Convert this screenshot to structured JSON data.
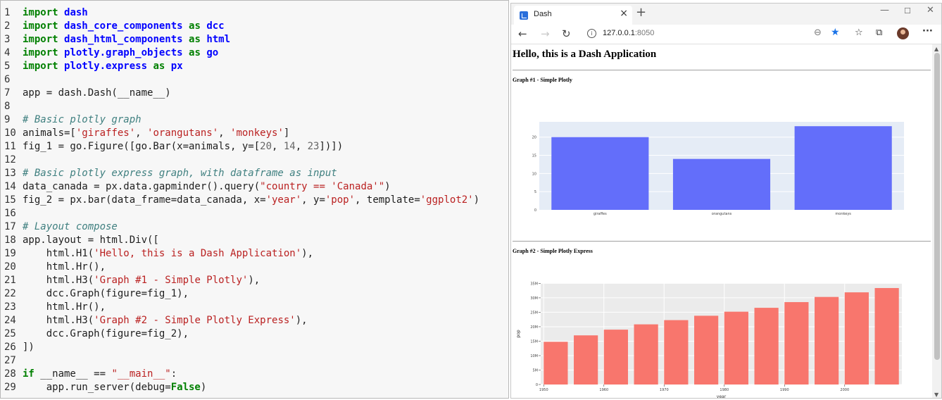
{
  "editor": {
    "lines": [
      {
        "n": "1",
        "tokens": [
          {
            "t": "kw",
            "v": "import"
          },
          {
            "t": "plain",
            "v": " "
          },
          {
            "t": "mod",
            "v": "dash"
          }
        ]
      },
      {
        "n": "2",
        "tokens": [
          {
            "t": "kw",
            "v": "import"
          },
          {
            "t": "plain",
            "v": " "
          },
          {
            "t": "mod",
            "v": "dash_core_components"
          },
          {
            "t": "plain",
            "v": " "
          },
          {
            "t": "kw",
            "v": "as"
          },
          {
            "t": "plain",
            "v": " "
          },
          {
            "t": "mod",
            "v": "dcc"
          }
        ]
      },
      {
        "n": "3",
        "tokens": [
          {
            "t": "kw",
            "v": "import"
          },
          {
            "t": "plain",
            "v": " "
          },
          {
            "t": "mod",
            "v": "dash_html_components"
          },
          {
            "t": "plain",
            "v": " "
          },
          {
            "t": "kw",
            "v": "as"
          },
          {
            "t": "plain",
            "v": " "
          },
          {
            "t": "mod",
            "v": "html"
          }
        ]
      },
      {
        "n": "4",
        "tokens": [
          {
            "t": "kw",
            "v": "import"
          },
          {
            "t": "plain",
            "v": " "
          },
          {
            "t": "mod",
            "v": "plotly.graph_objects"
          },
          {
            "t": "plain",
            "v": " "
          },
          {
            "t": "kw",
            "v": "as"
          },
          {
            "t": "plain",
            "v": " "
          },
          {
            "t": "mod",
            "v": "go"
          }
        ]
      },
      {
        "n": "5",
        "tokens": [
          {
            "t": "kw",
            "v": "import"
          },
          {
            "t": "plain",
            "v": " "
          },
          {
            "t": "mod",
            "v": "plotly.express"
          },
          {
            "t": "plain",
            "v": " "
          },
          {
            "t": "kw",
            "v": "as"
          },
          {
            "t": "plain",
            "v": " "
          },
          {
            "t": "mod",
            "v": "px"
          }
        ]
      },
      {
        "n": "6",
        "tokens": []
      },
      {
        "n": "7",
        "tokens": [
          {
            "t": "plain",
            "v": "app = dash.Dash(__name__)"
          }
        ]
      },
      {
        "n": "8",
        "tokens": []
      },
      {
        "n": "9",
        "tokens": [
          {
            "t": "com",
            "v": "# Basic plotly graph"
          }
        ]
      },
      {
        "n": "10",
        "tokens": [
          {
            "t": "plain",
            "v": "animals=["
          },
          {
            "t": "str",
            "v": "'giraffes'"
          },
          {
            "t": "plain",
            "v": ", "
          },
          {
            "t": "str",
            "v": "'orangutans'"
          },
          {
            "t": "plain",
            "v": ", "
          },
          {
            "t": "str",
            "v": "'monkeys'"
          },
          {
            "t": "plain",
            "v": "]"
          }
        ]
      },
      {
        "n": "11",
        "tokens": [
          {
            "t": "plain",
            "v": "fig_1 = go.Figure([go.Bar(x=animals, y=["
          },
          {
            "t": "num",
            "v": "20"
          },
          {
            "t": "plain",
            "v": ", "
          },
          {
            "t": "num",
            "v": "14"
          },
          {
            "t": "plain",
            "v": ", "
          },
          {
            "t": "num",
            "v": "23"
          },
          {
            "t": "plain",
            "v": "])])"
          }
        ]
      },
      {
        "n": "12",
        "tokens": []
      },
      {
        "n": "13",
        "tokens": [
          {
            "t": "com",
            "v": "# Basic plotly express graph, with dataframe as input"
          }
        ]
      },
      {
        "n": "14",
        "tokens": [
          {
            "t": "plain",
            "v": "data_canada = px.data.gapminder().query("
          },
          {
            "t": "str",
            "v": "\"country == 'Canada'\""
          },
          {
            "t": "plain",
            "v": ")"
          }
        ]
      },
      {
        "n": "15",
        "tokens": [
          {
            "t": "plain",
            "v": "fig_2 = px.bar(data_frame=data_canada, x="
          },
          {
            "t": "str",
            "v": "'year'"
          },
          {
            "t": "plain",
            "v": ", y="
          },
          {
            "t": "str",
            "v": "'pop'"
          },
          {
            "t": "plain",
            "v": ", template="
          },
          {
            "t": "str",
            "v": "'ggplot2'"
          },
          {
            "t": "plain",
            "v": ")"
          }
        ]
      },
      {
        "n": "16",
        "tokens": []
      },
      {
        "n": "17",
        "tokens": [
          {
            "t": "com",
            "v": "# Layout compose"
          }
        ]
      },
      {
        "n": "18",
        "tokens": [
          {
            "t": "plain",
            "v": "app.layout = html.Div(["
          }
        ]
      },
      {
        "n": "19",
        "tokens": [
          {
            "t": "plain",
            "v": "    html.H1("
          },
          {
            "t": "str",
            "v": "'Hello, this is a Dash Application'"
          },
          {
            "t": "plain",
            "v": "),"
          }
        ]
      },
      {
        "n": "20",
        "tokens": [
          {
            "t": "plain",
            "v": "    html.Hr(),"
          }
        ]
      },
      {
        "n": "21",
        "tokens": [
          {
            "t": "plain",
            "v": "    html.H3("
          },
          {
            "t": "str",
            "v": "'Graph #1 - Simple Plotly'"
          },
          {
            "t": "plain",
            "v": "),"
          }
        ]
      },
      {
        "n": "22",
        "tokens": [
          {
            "t": "plain",
            "v": "    dcc.Graph(figure=fig_1),"
          }
        ]
      },
      {
        "n": "23",
        "tokens": [
          {
            "t": "plain",
            "v": "    html.Hr(),"
          }
        ]
      },
      {
        "n": "24",
        "tokens": [
          {
            "t": "plain",
            "v": "    html.H3("
          },
          {
            "t": "str",
            "v": "'Graph #2 - Simple Plotly Express'"
          },
          {
            "t": "plain",
            "v": "),"
          }
        ]
      },
      {
        "n": "25",
        "tokens": [
          {
            "t": "plain",
            "v": "    dcc.Graph(figure=fig_2),"
          }
        ]
      },
      {
        "n": "26",
        "tokens": [
          {
            "t": "plain",
            "v": "])"
          }
        ]
      },
      {
        "n": "27",
        "tokens": []
      },
      {
        "n": "28",
        "tokens": [
          {
            "t": "kw",
            "v": "if"
          },
          {
            "t": "plain",
            "v": " __name__ == "
          },
          {
            "t": "str",
            "v": "\"__main__\""
          },
          {
            "t": "plain",
            "v": ":"
          }
        ]
      },
      {
        "n": "29",
        "tokens": [
          {
            "t": "plain",
            "v": "    app.run_server(debug="
          },
          {
            "t": "kw",
            "v": "False"
          },
          {
            "t": "plain",
            "v": ")"
          }
        ]
      }
    ]
  },
  "browser": {
    "tab_title": "Dash",
    "tab_close": "×",
    "new_tab": "+",
    "window_controls": {
      "minimize": "—",
      "maximize": "☐",
      "close": "✕"
    },
    "nav": {
      "back": "←",
      "forward": "→",
      "refresh": "↻"
    },
    "url_host": "127.0.0.1",
    "url_port": ":8050",
    "icons": {
      "info": "i",
      "zoom": "⊖",
      "favorite": "★",
      "favorites_bar": "☆",
      "collections": "⧉",
      "more": "···"
    }
  },
  "page": {
    "h1": "Hello, this is a Dash Application",
    "h3_graph1": "Graph #1 - Simple Plotly",
    "h3_graph2": "Graph #2 - Simple Plotly Express"
  },
  "chart_data": [
    {
      "type": "bar",
      "categories": [
        "giraffes",
        "orangutans",
        "monkeys"
      ],
      "values": [
        20,
        14,
        23
      ],
      "yticks": [
        0,
        5,
        10,
        15,
        20
      ],
      "ylim": [
        0,
        24.2
      ],
      "grid": true,
      "colors": {
        "bar": "#636efa",
        "plot_bg": "#e5ecf6",
        "grid": "#ffffff",
        "tick_text": "#444444"
      }
    },
    {
      "type": "bar",
      "x": [
        1952,
        1957,
        1962,
        1967,
        1972,
        1977,
        1982,
        1987,
        1992,
        1997,
        2002,
        2007
      ],
      "values": [
        14785584,
        17010154,
        18985849,
        20819767,
        22284500,
        23796400,
        25201900,
        26549700,
        28523502,
        30305843,
        31902268,
        33390141
      ],
      "xticks": [
        1950,
        1960,
        1970,
        1980,
        1990,
        2000
      ],
      "yticks": [
        0,
        5000000,
        10000000,
        15000000,
        20000000,
        25000000,
        30000000,
        35000000
      ],
      "ytick_labels": [
        "0",
        "5M",
        "10M",
        "15M",
        "20M",
        "25M",
        "30M",
        "35M"
      ],
      "xlim": [
        1949.5,
        2009.5
      ],
      "ylim": [
        0,
        35100000
      ],
      "xlabel": "year",
      "ylabel": "pop",
      "grid": true,
      "colors": {
        "bar": "#f8766d",
        "plot_bg": "#ebebeb",
        "grid": "#ffffff",
        "tick_text": "#444444"
      }
    }
  ]
}
